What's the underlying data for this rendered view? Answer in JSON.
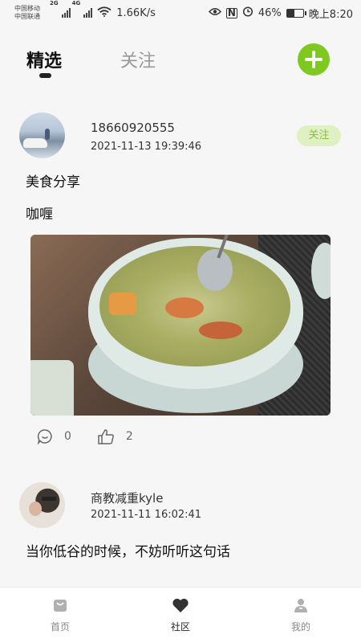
{
  "status_bar": {
    "carrier_1": "中国移动",
    "carrier_2": "中国联通",
    "network_1": "2G",
    "network_2": "4G",
    "net_speed": "1.66K/s",
    "battery": "46%",
    "battery_level": 0.46,
    "time": "晚上8:20",
    "nfc": "N"
  },
  "header": {
    "tabs": [
      {
        "label": "精选",
        "active": true
      },
      {
        "label": "关注",
        "active": false
      }
    ],
    "add_icon": "plus-icon",
    "accent_color": "#7ec81f"
  },
  "feed": {
    "posts": [
      {
        "username": "18660920555",
        "timestamp": "2021-11-13 19:39:46",
        "follow_label": "关注",
        "title": "美食分享",
        "text": "咖喱",
        "comments": "0",
        "likes": "2"
      },
      {
        "username": "商教减重kyle",
        "timestamp": "2021-11-11 16:02:41",
        "title": "当你低谷的时候，不妨听听这句话"
      }
    ]
  },
  "bottom_nav": {
    "items": [
      {
        "label": "首页",
        "icon": "bag-icon",
        "active": false
      },
      {
        "label": "社区",
        "icon": "heart-icon",
        "active": true
      },
      {
        "label": "我的",
        "icon": "user-icon",
        "active": false
      }
    ]
  }
}
